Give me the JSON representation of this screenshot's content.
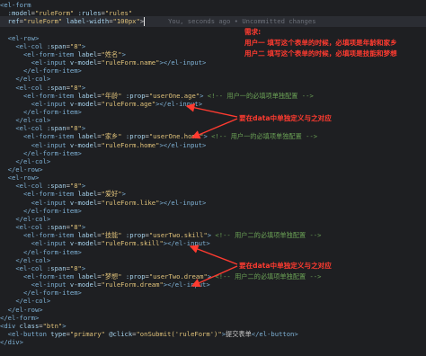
{
  "editor": {
    "lines": [
      [
        [
          "t",
          "<el-form"
        ]
      ],
      [
        [
          "p",
          "  "
        ],
        [
          "a",
          ":model"
        ],
        [
          "p",
          "="
        ],
        [
          "s",
          "\"ruleForm\""
        ],
        [
          "p",
          " "
        ],
        [
          "a",
          ":rules"
        ],
        [
          "p",
          "="
        ],
        [
          "s",
          "\"rules\""
        ]
      ],
      [
        [
          "p",
          "  "
        ],
        [
          "a",
          "ref"
        ],
        [
          "p",
          "="
        ],
        [
          "s",
          "\"ruleForm\""
        ],
        [
          "p",
          " "
        ],
        [
          "a",
          "label-width"
        ],
        [
          "p",
          "="
        ],
        [
          "s",
          "\"100px\""
        ],
        [
          "p",
          ">"
        ],
        [
          "caret",
          ""
        ],
        [
          "g",
          "      You, seconds ago • Uncommitted changes"
        ]
      ],
      [
        [
          "p",
          ""
        ]
      ],
      [
        [
          "p",
          "  "
        ],
        [
          "t",
          "<el-row>"
        ]
      ],
      [
        [
          "p",
          "    "
        ],
        [
          "t",
          "<el-col"
        ],
        [
          "p",
          " "
        ],
        [
          "a",
          ":span"
        ],
        [
          "p",
          "="
        ],
        [
          "s",
          "\"8\""
        ],
        [
          "t",
          ">"
        ]
      ],
      [
        [
          "p",
          "      "
        ],
        [
          "t",
          "<el-form-item"
        ],
        [
          "p",
          " "
        ],
        [
          "a",
          "label"
        ],
        [
          "p",
          "="
        ],
        [
          "s",
          "\"姓名\""
        ],
        [
          "t",
          ">"
        ]
      ],
      [
        [
          "p",
          "        "
        ],
        [
          "t",
          "<el-input"
        ],
        [
          "p",
          " "
        ],
        [
          "a",
          "v-model"
        ],
        [
          "p",
          "="
        ],
        [
          "s",
          "\"ruleForm.name\""
        ],
        [
          "t",
          "></el-input>"
        ]
      ],
      [
        [
          "p",
          "      "
        ],
        [
          "t",
          "</el-form-item>"
        ]
      ],
      [
        [
          "p",
          "    "
        ],
        [
          "t",
          "</el-col>"
        ]
      ],
      [
        [
          "p",
          "    "
        ],
        [
          "t",
          "<el-col"
        ],
        [
          "p",
          " "
        ],
        [
          "a",
          ":span"
        ],
        [
          "p",
          "="
        ],
        [
          "s",
          "\"8\""
        ],
        [
          "t",
          ">"
        ]
      ],
      [
        [
          "p",
          "      "
        ],
        [
          "t",
          "<el-form-item"
        ],
        [
          "p",
          " "
        ],
        [
          "a",
          "label"
        ],
        [
          "p",
          "="
        ],
        [
          "s",
          "\"年龄\""
        ],
        [
          "p",
          " "
        ],
        [
          "a",
          ":prop"
        ],
        [
          "p",
          "="
        ],
        [
          "s",
          "\"userOne.age\""
        ],
        [
          "t",
          ">"
        ],
        [
          "c",
          " <!-- 用户一的必填项单独配置 -->"
        ]
      ],
      [
        [
          "p",
          "        "
        ],
        [
          "t",
          "<el-input"
        ],
        [
          "p",
          " "
        ],
        [
          "a",
          "v-model"
        ],
        [
          "p",
          "="
        ],
        [
          "s",
          "\"ruleForm.age\""
        ],
        [
          "t",
          "></el-input>"
        ]
      ],
      [
        [
          "p",
          "      "
        ],
        [
          "t",
          "</el-form-item>"
        ]
      ],
      [
        [
          "p",
          "    "
        ],
        [
          "t",
          "</el-col>"
        ]
      ],
      [
        [
          "p",
          "    "
        ],
        [
          "t",
          "<el-col"
        ],
        [
          "p",
          " "
        ],
        [
          "a",
          ":span"
        ],
        [
          "p",
          "="
        ],
        [
          "s",
          "\"8\""
        ],
        [
          "t",
          ">"
        ]
      ],
      [
        [
          "p",
          "      "
        ],
        [
          "t",
          "<el-form-item"
        ],
        [
          "p",
          " "
        ],
        [
          "a",
          "label"
        ],
        [
          "p",
          "="
        ],
        [
          "s",
          "\"家乡\""
        ],
        [
          "p",
          " "
        ],
        [
          "a",
          ":prop"
        ],
        [
          "p",
          "="
        ],
        [
          "s",
          "\"userOne.home\""
        ],
        [
          "t",
          ">"
        ],
        [
          "c",
          " <!-- 用户一的必填项单独配置 -->"
        ]
      ],
      [
        [
          "p",
          "        "
        ],
        [
          "t",
          "<el-input"
        ],
        [
          "p",
          " "
        ],
        [
          "a",
          "v-model"
        ],
        [
          "p",
          "="
        ],
        [
          "s",
          "\"ruleForm.home\""
        ],
        [
          "t",
          "></el-input>"
        ]
      ],
      [
        [
          "p",
          "      "
        ],
        [
          "t",
          "</el-form-item>"
        ]
      ],
      [
        [
          "p",
          "    "
        ],
        [
          "t",
          "</el-col>"
        ]
      ],
      [
        [
          "p",
          "  "
        ],
        [
          "t",
          "</el-row>"
        ]
      ],
      [
        [
          "p",
          "  "
        ],
        [
          "t",
          "<el-row>"
        ]
      ],
      [
        [
          "p",
          "    "
        ],
        [
          "t",
          "<el-col"
        ],
        [
          "p",
          " "
        ],
        [
          "a",
          ":span"
        ],
        [
          "p",
          "="
        ],
        [
          "s",
          "\"8\""
        ],
        [
          "t",
          ">"
        ]
      ],
      [
        [
          "p",
          "      "
        ],
        [
          "t",
          "<el-form-item"
        ],
        [
          "p",
          " "
        ],
        [
          "a",
          "label"
        ],
        [
          "p",
          "="
        ],
        [
          "s",
          "\"爱好\""
        ],
        [
          "t",
          ">"
        ]
      ],
      [
        [
          "p",
          "        "
        ],
        [
          "t",
          "<el-input"
        ],
        [
          "p",
          " "
        ],
        [
          "a",
          "v-model"
        ],
        [
          "p",
          "="
        ],
        [
          "s",
          "\"ruleForm.like\""
        ],
        [
          "t",
          "></el-input>"
        ]
      ],
      [
        [
          "p",
          "      "
        ],
        [
          "t",
          "</el-form-item>"
        ]
      ],
      [
        [
          "p",
          "    "
        ],
        [
          "t",
          "</el-col>"
        ]
      ],
      [
        [
          "p",
          "    "
        ],
        [
          "t",
          "<el-col"
        ],
        [
          "p",
          " "
        ],
        [
          "a",
          ":span"
        ],
        [
          "p",
          "="
        ],
        [
          "s",
          "\"8\""
        ],
        [
          "t",
          ">"
        ]
      ],
      [
        [
          "p",
          "      "
        ],
        [
          "t",
          "<el-form-item"
        ],
        [
          "p",
          " "
        ],
        [
          "a",
          "label"
        ],
        [
          "p",
          "="
        ],
        [
          "s",
          "\"技能\""
        ],
        [
          "p",
          " "
        ],
        [
          "a",
          ":prop"
        ],
        [
          "p",
          "="
        ],
        [
          "s",
          "\"userTwo.skill\""
        ],
        [
          "t",
          ">"
        ],
        [
          "c",
          " <!-- 用户二的必填项单独配置 -->"
        ]
      ],
      [
        [
          "p",
          "        "
        ],
        [
          "t",
          "<el-input"
        ],
        [
          "p",
          " "
        ],
        [
          "a",
          "v-model"
        ],
        [
          "p",
          "="
        ],
        [
          "s",
          "\"ruleForm.skill\""
        ],
        [
          "t",
          "></el-input>"
        ]
      ],
      [
        [
          "p",
          "      "
        ],
        [
          "t",
          "</el-form-item>"
        ]
      ],
      [
        [
          "p",
          "    "
        ],
        [
          "t",
          "</el-col>"
        ]
      ],
      [
        [
          "p",
          "    "
        ],
        [
          "t",
          "<el-col"
        ],
        [
          "p",
          " "
        ],
        [
          "a",
          ":span"
        ],
        [
          "p",
          "="
        ],
        [
          "s",
          "\"8\""
        ],
        [
          "t",
          ">"
        ]
      ],
      [
        [
          "p",
          "      "
        ],
        [
          "t",
          "<el-form-item"
        ],
        [
          "p",
          " "
        ],
        [
          "a",
          "label"
        ],
        [
          "p",
          "="
        ],
        [
          "s",
          "\"梦想\""
        ],
        [
          "p",
          " "
        ],
        [
          "a",
          ":prop"
        ],
        [
          "p",
          "="
        ],
        [
          "s",
          "\"userTwo.dream\""
        ],
        [
          "t",
          ">"
        ],
        [
          "c",
          " <!-- 用户二的必填项单独配置 -->"
        ]
      ],
      [
        [
          "p",
          "        "
        ],
        [
          "t",
          "<el-input"
        ],
        [
          "p",
          " "
        ],
        [
          "a",
          "v-model"
        ],
        [
          "p",
          "="
        ],
        [
          "s",
          "\"ruleForm.dream\""
        ],
        [
          "t",
          "></el-input>"
        ]
      ],
      [
        [
          "p",
          "      "
        ],
        [
          "t",
          "</el-form-item>"
        ]
      ],
      [
        [
          "p",
          "    "
        ],
        [
          "t",
          "</el-col>"
        ]
      ],
      [
        [
          "p",
          "  "
        ],
        [
          "t",
          "</el-row>"
        ]
      ],
      [
        [
          "t",
          "</el-form>"
        ]
      ],
      [
        [
          "t",
          "<div"
        ],
        [
          "p",
          " "
        ],
        [
          "a",
          "class"
        ],
        [
          "p",
          "="
        ],
        [
          "s",
          "\"btn\""
        ],
        [
          "t",
          ">"
        ]
      ],
      [
        [
          "p",
          "  "
        ],
        [
          "t",
          "<el-button"
        ],
        [
          "p",
          " "
        ],
        [
          "a",
          "type"
        ],
        [
          "p",
          "="
        ],
        [
          "s",
          "\"primary\""
        ],
        [
          "p",
          " "
        ],
        [
          "a",
          "@click"
        ],
        [
          "p",
          "="
        ],
        [
          "s",
          "\"onSubmit('ruleForm')\""
        ],
        [
          "t",
          ">"
        ],
        [
          "p",
          "提交表单"
        ],
        [
          "t",
          "</el-button>"
        ]
      ],
      [
        [
          "t",
          "</div>"
        ]
      ]
    ]
  },
  "annotations": {
    "requirement_title": "需求:",
    "requirement_user1": "用户一 填写这个表单的时候，必填项是年龄和家乡",
    "requirement_user2": "用户二 填写这个表单的时候，必填项是技能和梦想",
    "note_user1": "要在data中单独定义与之对应",
    "note_user2": "要在data中单独定义与之对应"
  },
  "colors": {
    "background": "#1e1f22",
    "tag": "#7fb2d6",
    "attribute": "#a8d4ee",
    "string": "#e0c27a",
    "comment": "#6aa055",
    "annotation_red": "#ff3b30"
  }
}
